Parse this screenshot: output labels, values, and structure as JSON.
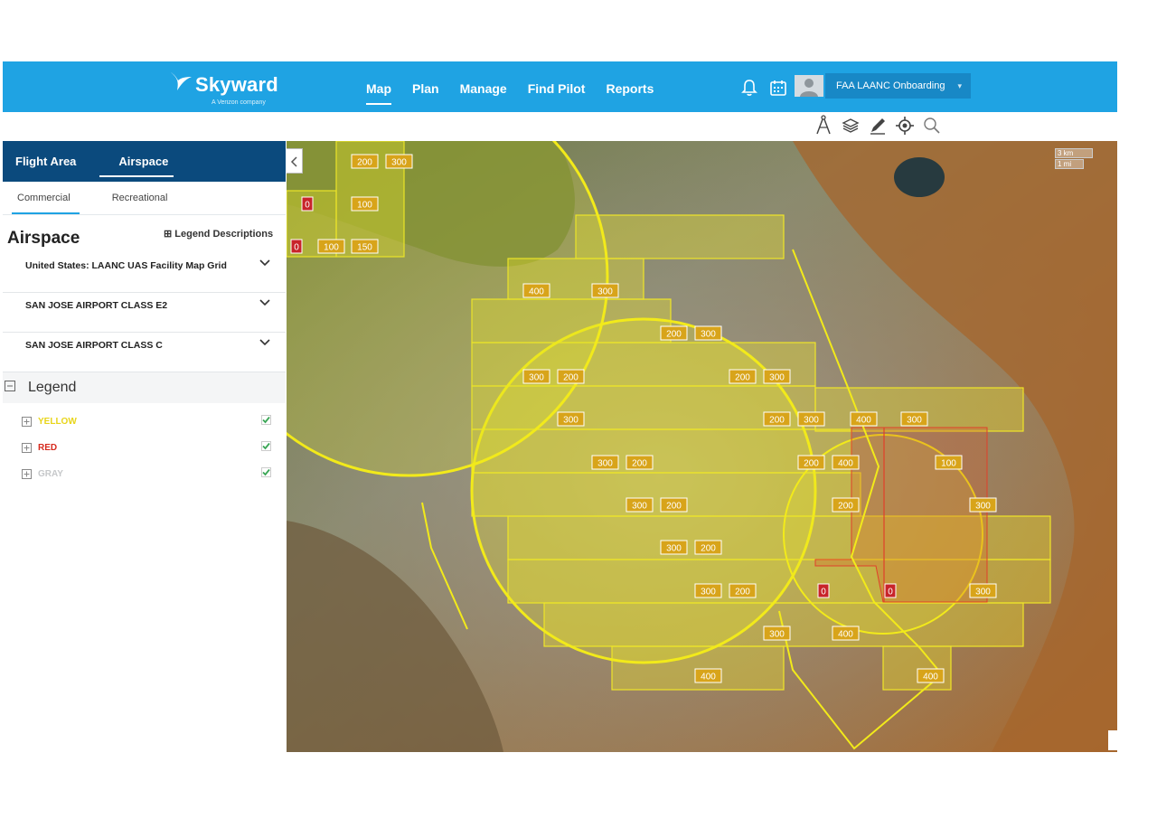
{
  "brand": {
    "name": "Skyward",
    "tagline": "A Verizon company",
    "color": "#1fa3e3",
    "dark_color": "#0b4a7d"
  },
  "nav": [
    {
      "label": "Map",
      "active": true
    },
    {
      "label": "Plan",
      "active": false
    },
    {
      "label": "Manage",
      "active": false
    },
    {
      "label": "Find Pilot",
      "active": false
    },
    {
      "label": "Reports",
      "active": false
    }
  ],
  "header_icons": [
    "bell-icon",
    "calendar-icon"
  ],
  "account": {
    "label": "FAA LAANC Onboarding"
  },
  "map_tools": [
    "compass-icon",
    "layers-icon",
    "pencil-icon",
    "locate-icon",
    "search-icon"
  ],
  "sidebar": {
    "tabs": [
      {
        "label": "Flight Area",
        "active": false
      },
      {
        "label": "Airspace",
        "active": true
      }
    ],
    "subtabs": [
      {
        "label": "Commercial",
        "active": true
      },
      {
        "label": "Recreational",
        "active": false
      }
    ],
    "airspace_title": "Airspace",
    "legend_descriptions": "Legend Descriptions",
    "accordions": [
      {
        "label": "United States: LAANC UAS Facility Map Grid"
      },
      {
        "label": "SAN JOSE AIRPORT CLASS E2"
      },
      {
        "label": "SAN JOSE AIRPORT CLASS C"
      }
    ],
    "legend_title": "Legend",
    "legend_items": [
      {
        "label": "YELLOW",
        "color": "#f2e21b",
        "checked": true
      },
      {
        "label": "RED",
        "color": "#d62a1e",
        "checked": true
      },
      {
        "label": "GRAY",
        "color": "#c6c8ca",
        "checked": true
      }
    ]
  },
  "map": {
    "scale": [
      "3 km",
      "1 mi"
    ],
    "grid_labels": [
      "200",
      "300",
      "0",
      "100",
      "0",
      "100",
      "150",
      "400",
      "300",
      "200",
      "300",
      "300",
      "200",
      "200",
      "300",
      "300",
      "200",
      "300",
      "400",
      "300",
      "300",
      "200",
      "200",
      "400",
      "100",
      "300",
      "200",
      "200",
      "300",
      "300",
      "200",
      "300",
      "200",
      "0",
      "0",
      "300",
      "300",
      "400",
      "400",
      "400"
    ]
  }
}
